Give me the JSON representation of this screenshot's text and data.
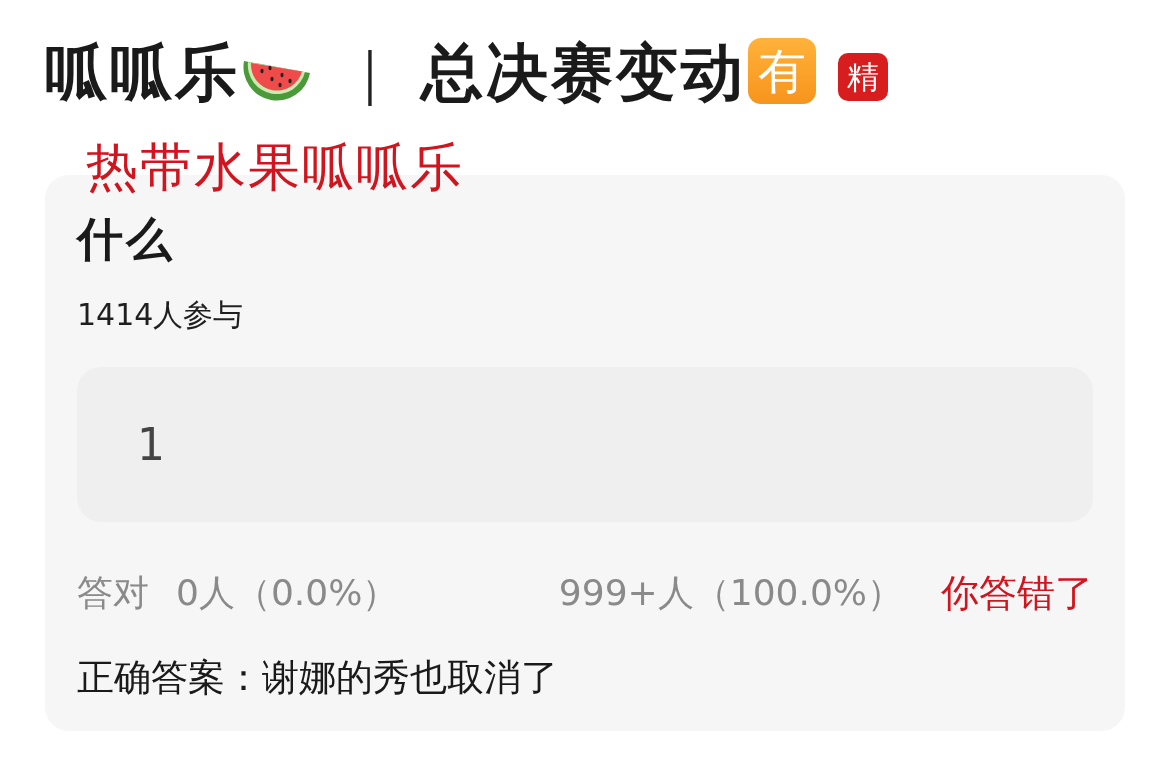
{
  "header": {
    "title": "呱呱乐",
    "separator": "｜",
    "subtitle": "总决赛变动",
    "emoji_badge": "有",
    "tag": "精"
  },
  "annotation": "热带水果呱呱乐",
  "quiz": {
    "question": "什么",
    "participants": "1414人参与",
    "answer": "1",
    "stats": {
      "correct_label": "答对",
      "correct_count": "0人（0.0%）",
      "wrong_count": "999+人（100.0%）"
    },
    "result": {
      "text": "你答错了",
      "correct": false
    },
    "correct_answer": "正确答案：谢娜的秀也取消了"
  }
}
